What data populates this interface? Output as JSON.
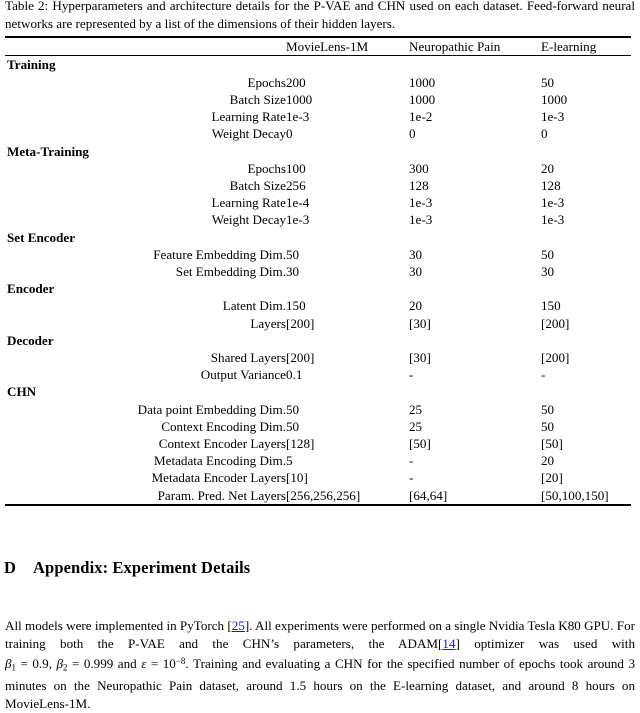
{
  "caption": {
    "label": "Table 2:",
    "text": "Table 2: Hyperparameters and architecture details for the P-VAE and CHN used on each dataset. Feed-forward neural networks are represented by a list of the dimensions of their hidden layers."
  },
  "table": {
    "columns": [
      "",
      "MovieLens-1M",
      "Neuropathic Pain",
      "E-learning"
    ],
    "sections": [
      {
        "name": "Training",
        "rows": [
          {
            "label": "Epochs",
            "values": [
              "200",
              "1000",
              "50"
            ]
          },
          {
            "label": "Batch Size",
            "values": [
              "1000",
              "1000",
              "1000"
            ]
          },
          {
            "label": "Learning Rate",
            "values": [
              "1e-3",
              "1e-2",
              "1e-3"
            ]
          },
          {
            "label": "Weight Decay",
            "values": [
              "0",
              "0",
              "0"
            ]
          }
        ]
      },
      {
        "name": "Meta-Training",
        "rows": [
          {
            "label": "Epochs",
            "values": [
              "100",
              "300",
              "20"
            ]
          },
          {
            "label": "Batch Size",
            "values": [
              "256",
              "128",
              "128"
            ]
          },
          {
            "label": "Learning Rate",
            "values": [
              "1e-4",
              "1e-3",
              "1e-3"
            ]
          },
          {
            "label": "Weight Decay",
            "values": [
              "1e-3",
              "1e-3",
              "1e-3"
            ]
          }
        ]
      },
      {
        "name": "Set Encoder",
        "rows": [
          {
            "label": "Feature Embedding Dim.",
            "values": [
              "50",
              "30",
              "50"
            ]
          },
          {
            "label": "Set Embedding Dim.",
            "values": [
              "30",
              "30",
              "30"
            ]
          }
        ]
      },
      {
        "name": "Encoder",
        "rows": [
          {
            "label": "Latent Dim.",
            "values": [
              "150",
              "20",
              "150"
            ]
          },
          {
            "label": "Layers",
            "values": [
              "[200]",
              "[30]",
              "[200]"
            ]
          }
        ]
      },
      {
        "name": "Decoder",
        "rows": [
          {
            "label": "Shared Layers",
            "values": [
              "[200]",
              "[30]",
              "[200]"
            ]
          },
          {
            "label": "Output Variance",
            "values": [
              "0.1",
              "-",
              "-"
            ]
          }
        ]
      },
      {
        "name": "CHN",
        "rows": [
          {
            "label": "Data point Embedding Dim.",
            "values": [
              "50",
              "25",
              "50"
            ]
          },
          {
            "label": "Context Encoding Dim.",
            "values": [
              "50",
              "25",
              "50"
            ]
          },
          {
            "label": "Context Encoder Layers",
            "values": [
              "[128]",
              "[50]",
              "[50]"
            ]
          },
          {
            "label": "Metadata Encoding Dim.",
            "values": [
              "5",
              "-",
              "20"
            ]
          },
          {
            "label": "Metadata Encoder Layers",
            "values": [
              "[10]",
              "-",
              "[20]"
            ]
          },
          {
            "label": "Param. Pred. Net Layers",
            "values": [
              "[256,256,256]",
              "[64,64]",
              "[50,100,150]"
            ]
          }
        ]
      }
    ]
  },
  "appendix": {
    "section_number": "D",
    "heading": "Appendix: Experiment Details",
    "paragraph": {
      "part1": "All models were implemented in PyTorch [",
      "cite1": "25",
      "part2": "]. All experiments were performed on a single Nvidia Tesla K80 GPU. For training both the P-VAE and the CHN’s parameters, the ADAM[",
      "cite2": "14",
      "part3": "] optimizer was used with ",
      "beta1_sym": "β",
      "beta1_sub": "1",
      "beta1_val": " = 0.9, ",
      "beta2_sym": "β",
      "beta2_sub": "2",
      "beta2_val": " = 0.999 and ",
      "eps_sym": "ε",
      "eps_val": " = 10",
      "eps_exp": "−8",
      "part4": ". Training and evaluating a CHN for the specified number of epochs took around 3 minutes on the Neuropathic Pain dataset, around 1.5 hours on the E-learning dataset, and around 8 hours on MovieLens-1M."
    }
  }
}
